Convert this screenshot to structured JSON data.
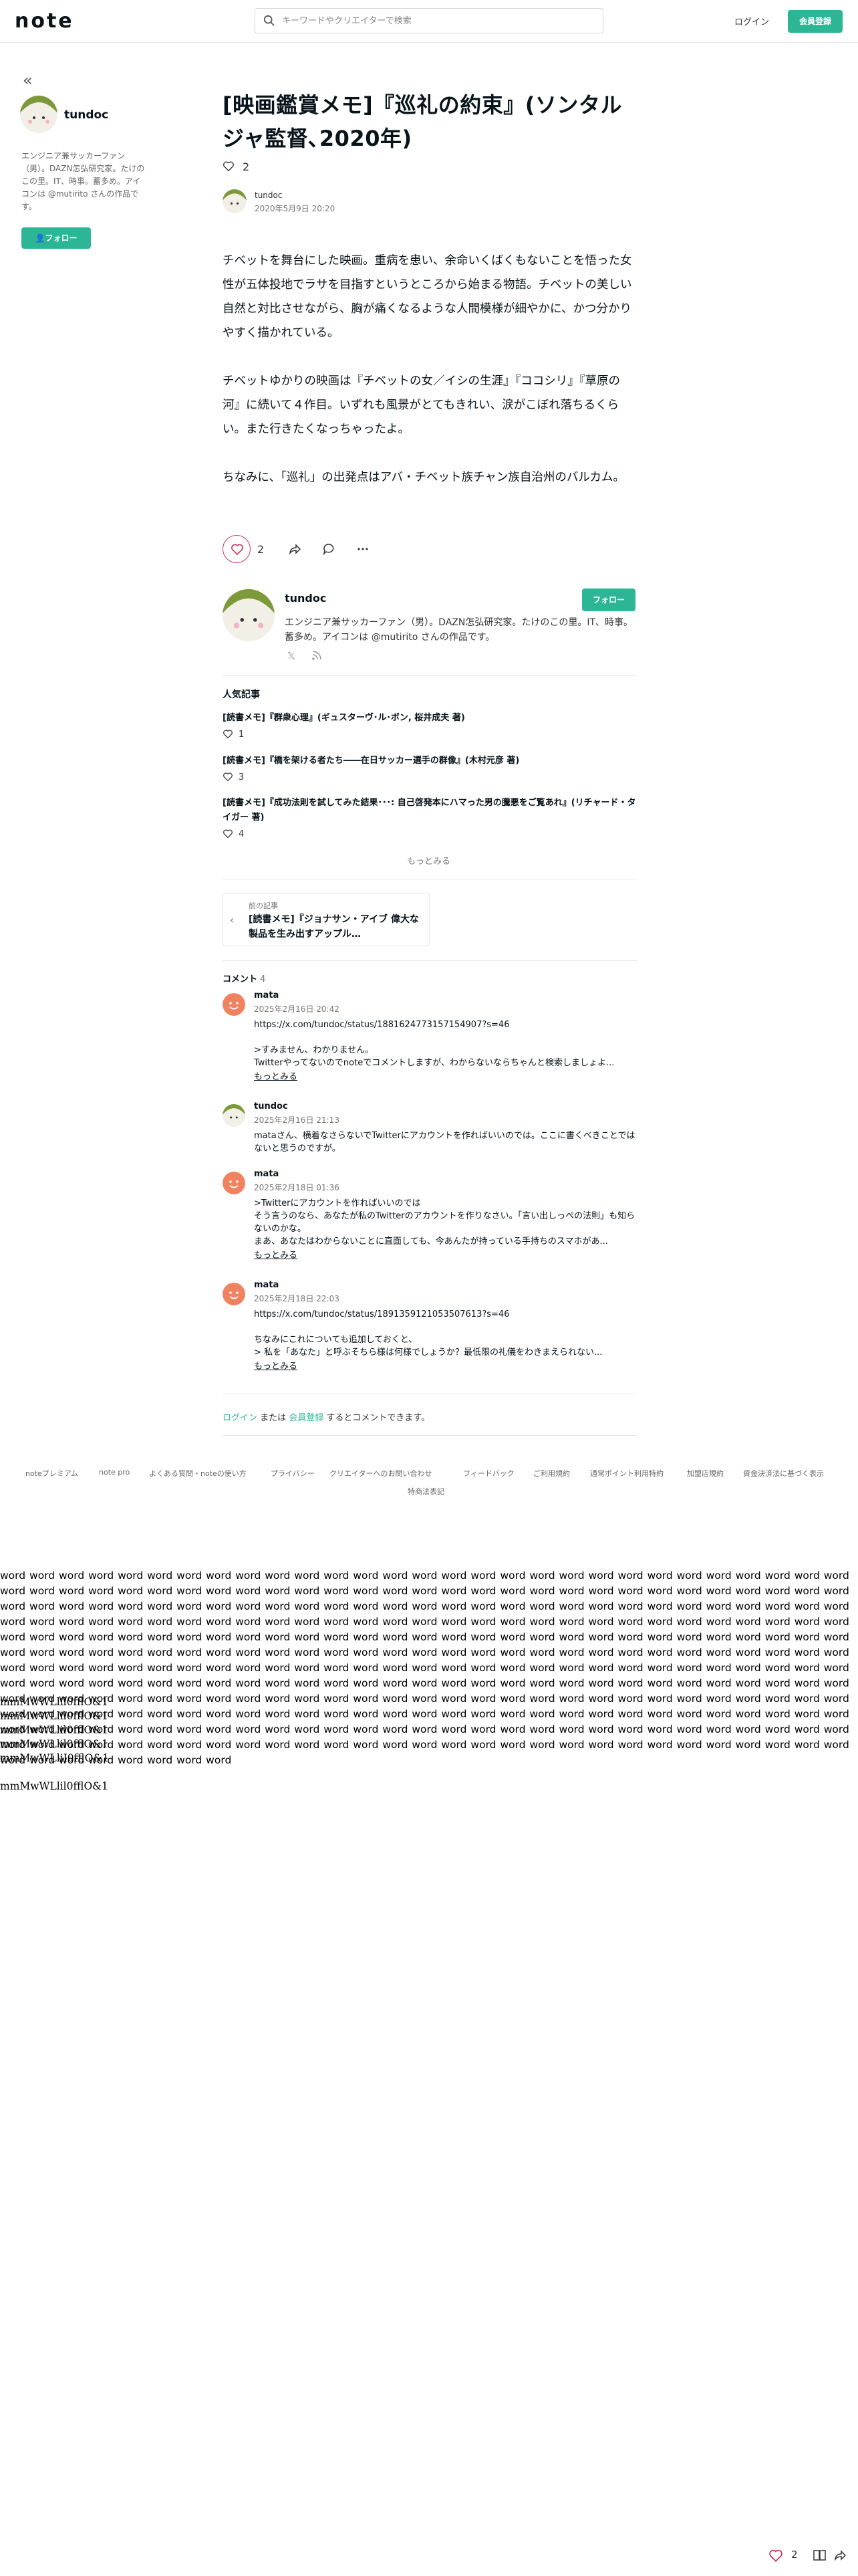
{
  "header": {
    "logo": "note",
    "search_placeholder": "キーワードやクリエイターで検索",
    "login": "ログイン",
    "signup": "会員登録"
  },
  "sidebar": {
    "author_name": "tundoc",
    "bio": "エンジニア兼サッカーファン（男）。DAZN怎弘研究家。たけのこの里。IT、時事。蓄多め。アイコンは @mutirito さんの作品です。",
    "follow": "フォロー"
  },
  "article": {
    "title": "[映画鑑賞メモ]『巡礼の約束』(ソンタルジャ監督､2020年)",
    "likes": "2",
    "author": "tundoc",
    "date": "2020年5月9日 20:20",
    "paragraphs": [
      "チベットを舞台にした映画。重病を患い、余命いくばくもないことを悟った女性が五体投地でラサを目指すというところから始まる物語。チベットの美しい自然と対比させながら、胸が痛くなるような人間模様が細やかに、かつ分かりやすく描かれている。",
      "チベットゆかりの映画は『チベットの女／イシの生涯』『ココシリ』『草原の河』に続いて４作目。いずれも風景がとてもきれい、涙がこぼれ落ちるくらい。また行きたくなっちゃったよ。",
      "ちなみに、「巡礼」の出発点はアバ・チベット族チャン族自治州のバルカム。"
    ]
  },
  "actions": {
    "like_count": "2"
  },
  "author_card": {
    "name": "tundoc",
    "follow": "フォロー",
    "bio": "エンジニア兼サッカーファン（男）。DAZN怎弘研究家。たけのこの里。IT、時事。蓄多め。アイコンは @mutirito さんの作品です。",
    "x_icon": "𝕏"
  },
  "popular": {
    "heading": "人気記事",
    "items": [
      {
        "title": "[読書メモ]『群衆心理』(ギュスターヴ･ル･ボン, 桜井成夫 著)",
        "likes": "1"
      },
      {
        "title": "[読書メモ]『橋を架ける者たち――在日サッカー選手の群像』(木村元彦 著)",
        "likes": "3"
      },
      {
        "title": "[読書メモ]『成功法則を試してみた結果･･･: 自己啓発本にハマった男の騰悪をご覧あれ』(リチャード・タイガー 著)",
        "likes": "4"
      }
    ],
    "more": "もっとみる"
  },
  "prev_article": {
    "label": "前の記事",
    "title": "[読書メモ]『ジョナサン・アイブ 偉大な製品を生み出すアップル…"
  },
  "comments": {
    "heading": "コメント",
    "count": "4",
    "items": [
      {
        "name": "mata",
        "date": "2025年2月16日 20:42",
        "lines": [
          "https://x.com/tundoc/status/1881624773157154907?s=46",
          "",
          ">すみません、わかりません。",
          "Twitterやってないのでnoteでコメントしますが、わからないならちゃんと検索しましょよ..."
        ],
        "more": "もっとみる"
      },
      {
        "name": "tundoc",
        "date": "2025年2月16日 21:13",
        "lines": [
          "mataさん、横着なさらないでTwitterにアカウントを作ればいいのでは。ここに書くべきことではないと思うのですが。"
        ],
        "more": ""
      },
      {
        "name": "mata",
        "date": "2025年2月18日 01:36",
        "lines": [
          ">Twitterにアカウントを作ればいいのでは",
          "そう言うのなら、あなたが私のTwitterのアカウントを作りなさい。「言い出しっぺの法則」も知らないのかな。",
          "まあ、あなたはわからないことに直面しても、今あんたが持っている手持ちのスマホがあ..."
        ],
        "more": "もっとみる"
      },
      {
        "name": "mata",
        "date": "2025年2月18日 22:03",
        "lines": [
          "https://x.com/tundoc/status/1891359121053507613?s=46",
          "",
          "ちなみにこれについても追加しておくと、",
          "> 私を「あなた」と呼ぶそちら様は何様でしょうか？最低限の礼儀をわきまえられない..."
        ],
        "more": "もっとみる"
      }
    ],
    "footer_login": "ログイン",
    "footer_or": " または ",
    "footer_signup": "会員登録",
    "footer_rest": " するとコメントできます。"
  },
  "footer": {
    "links": [
      "noteプレミアム",
      "note pro",
      "よくある質問・noteの使い方",
      "プライバシー",
      "クリエイターへのお問い合わせ",
      "フィードバック",
      "ご利用規約",
      "通常ポイント利用特約",
      "加盟店規約",
      "資金決済法に基づく表示",
      "特商法表記"
    ]
  },
  "filler": {
    "word_block": "word word word word word word word word word word word word word word word word word word word word word word word word word word word word word word word word word word word word word word word word word word word word word word word word word word word word word word word word word word word word word word word word word word word word word word word word word word word word word word word word word word word word word word word word word word word word word word word word word word word word word word word word word word word word word word word word word word word word word word word word word word word word word word word word word word word word word word word word word word word word word word word word word word word word word word word word word word word word word word word word word word word word word word word word word word word word word word word word word word word word word word word word word word word word word word word word word word word word word word word word word word word word word word word word word word word word word word word word word word word word word word word word word word word word word word word word word word word word word word word word word word word word word word word word word word word word word word word word word word word word word word word word word word word word word word word word word word word word word word word word word word word word word word word word word word word word word word word word word word word word word word word word word word word word word word word word word word word word word word word word word word word word word word word word word word word word word word word word word word word word word word word word word word word word word word word word word word word word",
    "glyph_lines": [
      "mmMwWLlil0fflO&1",
      "mmMwWLlil0fflO&1",
      "mmMwWLlil0fflO&1",
      "mmMwWLlil0fflO&1",
      "mmMwWLliI0fflO&1",
      "",
      "mmMwWLlil0fflO&1"
    ]
  },
  "bottom_bar": {
    "like_count": "2"
  },
  "colors": {
    "accent": "#2cb696",
    "like": "#c8375b"
  }
}
